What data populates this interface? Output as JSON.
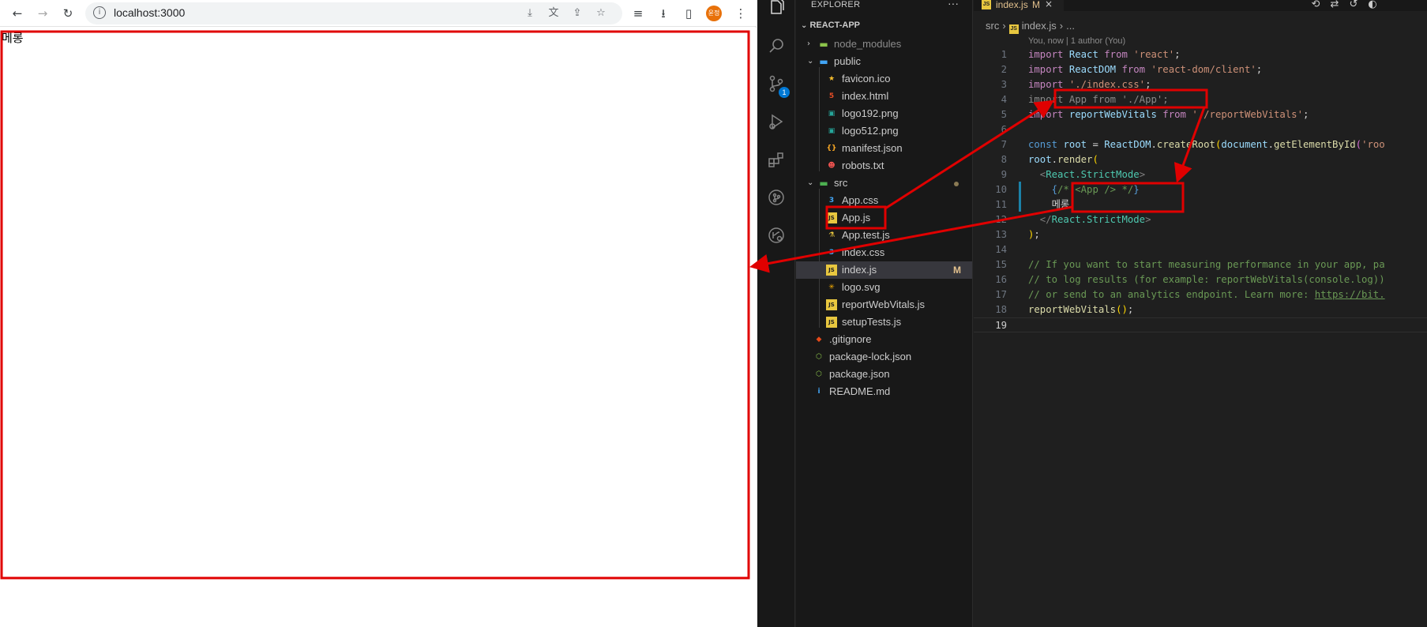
{
  "browser": {
    "url": "localhost:3000",
    "profile_initials": "윤정",
    "page_text": "메롱"
  },
  "vscode": {
    "explorer_title": "EXPLORER",
    "explorer_more": "···",
    "project_name": "REACT-APP",
    "tree": [
      {
        "label": "node_modules",
        "kind": "folder",
        "icon": "folder-node-icon",
        "icon_color": "#8bc34a",
        "dim": true
      },
      {
        "label": "public",
        "kind": "folder-open",
        "icon": "folder-public-icon",
        "icon_color": "#42a5f5"
      },
      {
        "label": "favicon.ico",
        "kind": "file",
        "icon": "star-icon",
        "icon_color": "#fbc02d"
      },
      {
        "label": "index.html",
        "kind": "file",
        "icon": "html-file-icon",
        "icon_color": "#e44d26"
      },
      {
        "label": "logo192.png",
        "kind": "file",
        "icon": "image-file-icon",
        "icon_color": "#26a69a"
      },
      {
        "label": "logo512.png",
        "kind": "file",
        "icon": "image-file-icon",
        "icon_color": "#26a69a"
      },
      {
        "label": "manifest.json",
        "kind": "file",
        "icon": "json-braces-icon",
        "icon_color": "#f9a825"
      },
      {
        "label": "robots.txt",
        "kind": "file",
        "icon": "robot-icon",
        "icon_color": "#ef5350"
      },
      {
        "label": "src",
        "kind": "folder-open",
        "icon": "folder-src-icon",
        "icon_color": "#4caf50"
      },
      {
        "label": "App.css",
        "kind": "file",
        "icon": "css-file-icon",
        "icon_color": "#42a5f5"
      },
      {
        "label": "App.js",
        "kind": "file",
        "icon": "js-file-icon",
        "icon_color": "#e8c73f"
      },
      {
        "label": "App.test.js",
        "kind": "file",
        "icon": "test-flask-icon",
        "icon_color": "#e8c73f"
      },
      {
        "label": "index.css",
        "kind": "file",
        "icon": "css-file-icon",
        "icon_color": "#42a5f5"
      },
      {
        "label": "index.js",
        "kind": "file",
        "icon": "js-file-icon",
        "icon_color": "#e8c73f",
        "badge": "M"
      },
      {
        "label": "logo.svg",
        "kind": "file",
        "icon": "svg-file-icon",
        "icon_color": "#ffb300"
      },
      {
        "label": "reportWebVitals.js",
        "kind": "file",
        "icon": "js-file-icon",
        "icon_color": "#e8c73f"
      },
      {
        "label": "setupTests.js",
        "kind": "file",
        "icon": "js-file-icon",
        "icon_color": "#e8c73f"
      },
      {
        "label": ".gitignore",
        "kind": "file",
        "icon": "git-icon",
        "icon_color": "#e64a19"
      },
      {
        "label": "package-lock.json",
        "kind": "file",
        "icon": "node-package-icon",
        "icon_color": "#8bc34a"
      },
      {
        "label": "package.json",
        "kind": "file",
        "icon": "node-package-icon",
        "icon_color": "#8bc34a"
      },
      {
        "label": "README.md",
        "kind": "file",
        "icon": "info-icon",
        "icon_color": "#42a5f5"
      }
    ],
    "scm_badge": "1",
    "tab": {
      "name": "index.js",
      "modified": "M",
      "close": "×"
    },
    "breadcrumb": {
      "folder": "src",
      "file": "index.js",
      "more": "..."
    },
    "blame": "You, now | 1 author (You)",
    "line_numbers": [
      "1",
      "2",
      "3",
      "4",
      "5",
      "6",
      "7",
      "8",
      "9",
      "10",
      "11",
      "12",
      "13",
      "14",
      "15",
      "16",
      "17",
      "18",
      "19"
    ],
    "code": {
      "l1": [
        "import",
        " ",
        "React",
        " ",
        "from",
        " ",
        "'react'",
        ";"
      ],
      "l2": [
        "import",
        " ",
        "ReactDOM",
        " ",
        "from",
        " ",
        "'react-dom/client'",
        ";"
      ],
      "l3": [
        "import",
        " ",
        "'./index.css'",
        ";"
      ],
      "l4": [
        "import App from './App';"
      ],
      "l5": [
        "import",
        " ",
        "reportWebVitals",
        " ",
        "from",
        " ",
        "'./reportWebVitals'",
        ";"
      ],
      "l7": [
        "const",
        " ",
        "root",
        " = ",
        "ReactDOM",
        ".",
        "createRoot",
        "(",
        "document",
        ".",
        "getElementById",
        "(",
        "'roo"
      ],
      "l8": [
        "root",
        ".",
        "render",
        "("
      ],
      "l9": [
        "  <",
        "React.StrictMode",
        ">"
      ],
      "l10": [
        "    ",
        "{",
        "/* <App /> */",
        "}"
      ],
      "l11": [
        "    메롱"
      ],
      "l12": [
        "  </",
        "React.StrictMode",
        ">"
      ],
      "l13": [
        ")",
        ";"
      ],
      "l15": [
        "// If you want to start measuring performance in your app, pa"
      ],
      "l16": [
        "// to log results (for example: reportWebVitals(console.log))"
      ],
      "l17": [
        "// or send to an analytics endpoint. Learn more: ",
        "https://bit."
      ],
      "l18": [
        "reportWebVitals",
        "(",
        ")",
        ";"
      ]
    }
  },
  "colors": {
    "annotation_red": "#e00000",
    "accent_blue": "#0078d4",
    "modified_gold": "#e2c08d"
  }
}
